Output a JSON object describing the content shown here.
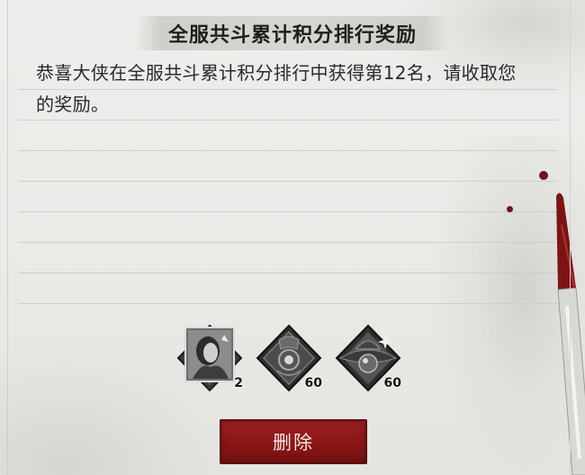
{
  "mail": {
    "title": "全服共斗累计积分排行奖励",
    "body_line1": "恭喜大侠在全服共斗累计积分排行中获得第12名，请收取您",
    "body_line2": "的奖励。"
  },
  "rewards": [
    {
      "icon": "hero-portrait-icon",
      "count": "2"
    },
    {
      "icon": "ornate-token-icon",
      "count": "60"
    },
    {
      "icon": "hat-pouch-icon",
      "count": "60"
    }
  ],
  "actions": {
    "delete_label": "删除"
  },
  "colors": {
    "paper": "#eeeeec",
    "button_red": "#8a1616",
    "ink_red": "#6e1515",
    "text": "#2a2a2a"
  }
}
